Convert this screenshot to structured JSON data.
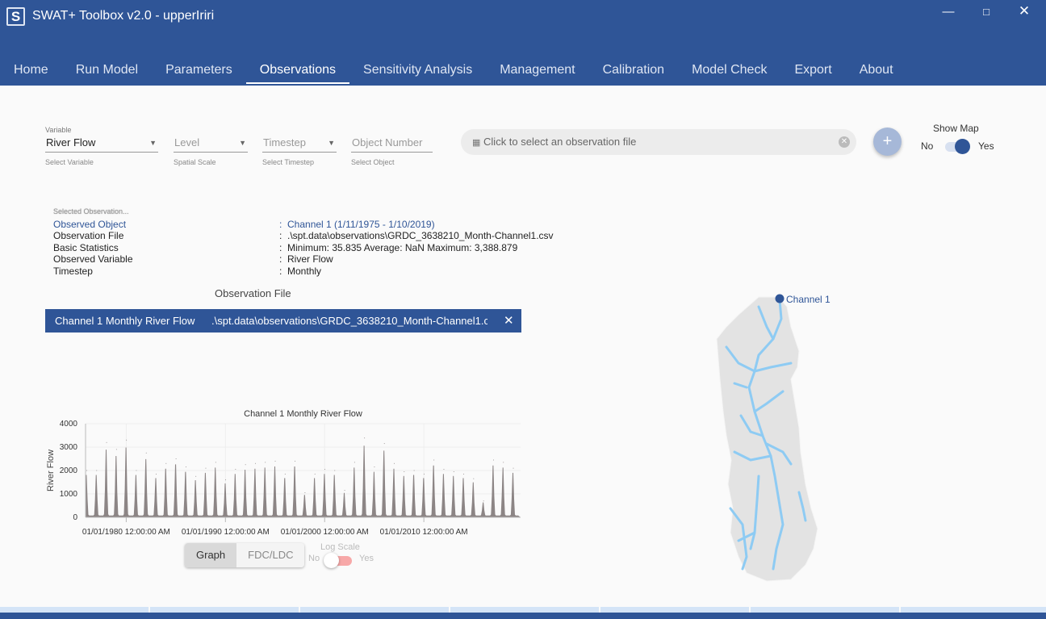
{
  "window": {
    "title": "SWAT+ Toolbox v2.0 - upperIriri",
    "logo_text": "S",
    "controls": [
      "minimize-icon",
      "maximize-icon",
      "close-icon"
    ]
  },
  "tabs": [
    {
      "label": "Home"
    },
    {
      "label": "Run Model"
    },
    {
      "label": "Parameters"
    },
    {
      "label": "Observations",
      "active": true
    },
    {
      "label": "Sensitivity Analysis"
    },
    {
      "label": "Management"
    },
    {
      "label": "Calibration"
    },
    {
      "label": "Model Check"
    },
    {
      "label": "Export"
    },
    {
      "label": "About"
    }
  ],
  "filters": {
    "variable": {
      "label": "Variable",
      "value": "River Flow",
      "hint": "Select Variable"
    },
    "level": {
      "placeholder": "Level",
      "hint": "Spatial Scale"
    },
    "timestep": {
      "placeholder": "Timestep",
      "hint": "Select Timestep"
    },
    "object": {
      "placeholder": "Object Number",
      "hint": "Select Object"
    }
  },
  "file_picker": {
    "placeholder": "Click to select an observation file",
    "icon": "excel-file-icon"
  },
  "add_button": "+",
  "show_map": {
    "label": "Show Map",
    "no": "No",
    "yes": "Yes",
    "value": true
  },
  "selected": {
    "heading": "Selected Observation...",
    "rows": [
      {
        "key": "Observed Object",
        "value": "Channel 1  (1/11/1975 - 1/10/2019)"
      },
      {
        "key": "Observation File",
        "value": ".\\spt.data\\observations\\GRDC_3638210_Month-Channel1.csv"
      },
      {
        "key": "Basic Statistics",
        "value": "Minimum: 35.835 Average: NaN Maximum: 3,388.879"
      },
      {
        "key": "Observed Variable",
        "value": "River Flow"
      },
      {
        "key": "Timestep",
        "value": "Monthly"
      }
    ]
  },
  "observation_file": {
    "header": "Observation File",
    "rows": [
      {
        "name": "Channel 1 Monthly River Flow",
        "path": ".\\spt.data\\observations\\GRDC_3638210_Month-Channel1.c"
      }
    ]
  },
  "chart_data": {
    "type": "area",
    "title": "Channel 1 Monthly River Flow",
    "ylabel": "River Flow",
    "xlabel": "",
    "ylim": [
      0,
      4000
    ],
    "yticks": [
      0,
      1000,
      2000,
      3000,
      4000
    ],
    "xlim": [
      1975.9,
      2019.75
    ],
    "xticks": [
      {
        "year": 1980,
        "label": "01/01/1980 12:00:00 AM"
      },
      {
        "year": 1990,
        "label": "01/01/1990 12:00:00 AM"
      },
      {
        "year": 2000,
        "label": "01/01/2000 12:00:00 AM"
      },
      {
        "year": 2010,
        "label": "01/01/2010 12:00:00 AM"
      }
    ],
    "grid": true,
    "color": "#8c8585",
    "annual_peaks": {
      "years": [
        1976,
        1977,
        1978,
        1979,
        1980,
        1981,
        1982,
        1983,
        1984,
        1985,
        1986,
        1987,
        1988,
        1989,
        1990,
        1991,
        1992,
        1993,
        1994,
        1995,
        1996,
        1997,
        1998,
        1999,
        2000,
        2001,
        2002,
        2003,
        2004,
        2005,
        2006,
        2007,
        2008,
        2009,
        2010,
        2011,
        2012,
        2013,
        2014,
        2015,
        2016,
        2017,
        2018,
        2019
      ],
      "values": [
        2000,
        2000,
        3200,
        2900,
        3300,
        2000,
        2750,
        1850,
        2300,
        2500,
        2150,
        1750,
        2100,
        2350,
        1600,
        2050,
        2250,
        2300,
        2350,
        2400,
        1850,
        2400,
        1050,
        1850,
        2050,
        2000,
        1150,
        2350,
        3389,
        2150,
        3150,
        2300,
        1950,
        2000,
        1850,
        2450,
        2050,
        1950,
        1850,
        1650,
        700,
        2450,
        2350,
        2100
      ]
    }
  },
  "view_toggle": {
    "options": [
      "Graph",
      "FDC/LDC"
    ],
    "selected": "Graph"
  },
  "log_scale": {
    "label": "Log Scale",
    "no": "No",
    "yes": "Yes",
    "value": false
  },
  "map": {
    "label": "Channel 1",
    "river_color": "#8ecbf3",
    "marker_color": "#2f5597"
  }
}
